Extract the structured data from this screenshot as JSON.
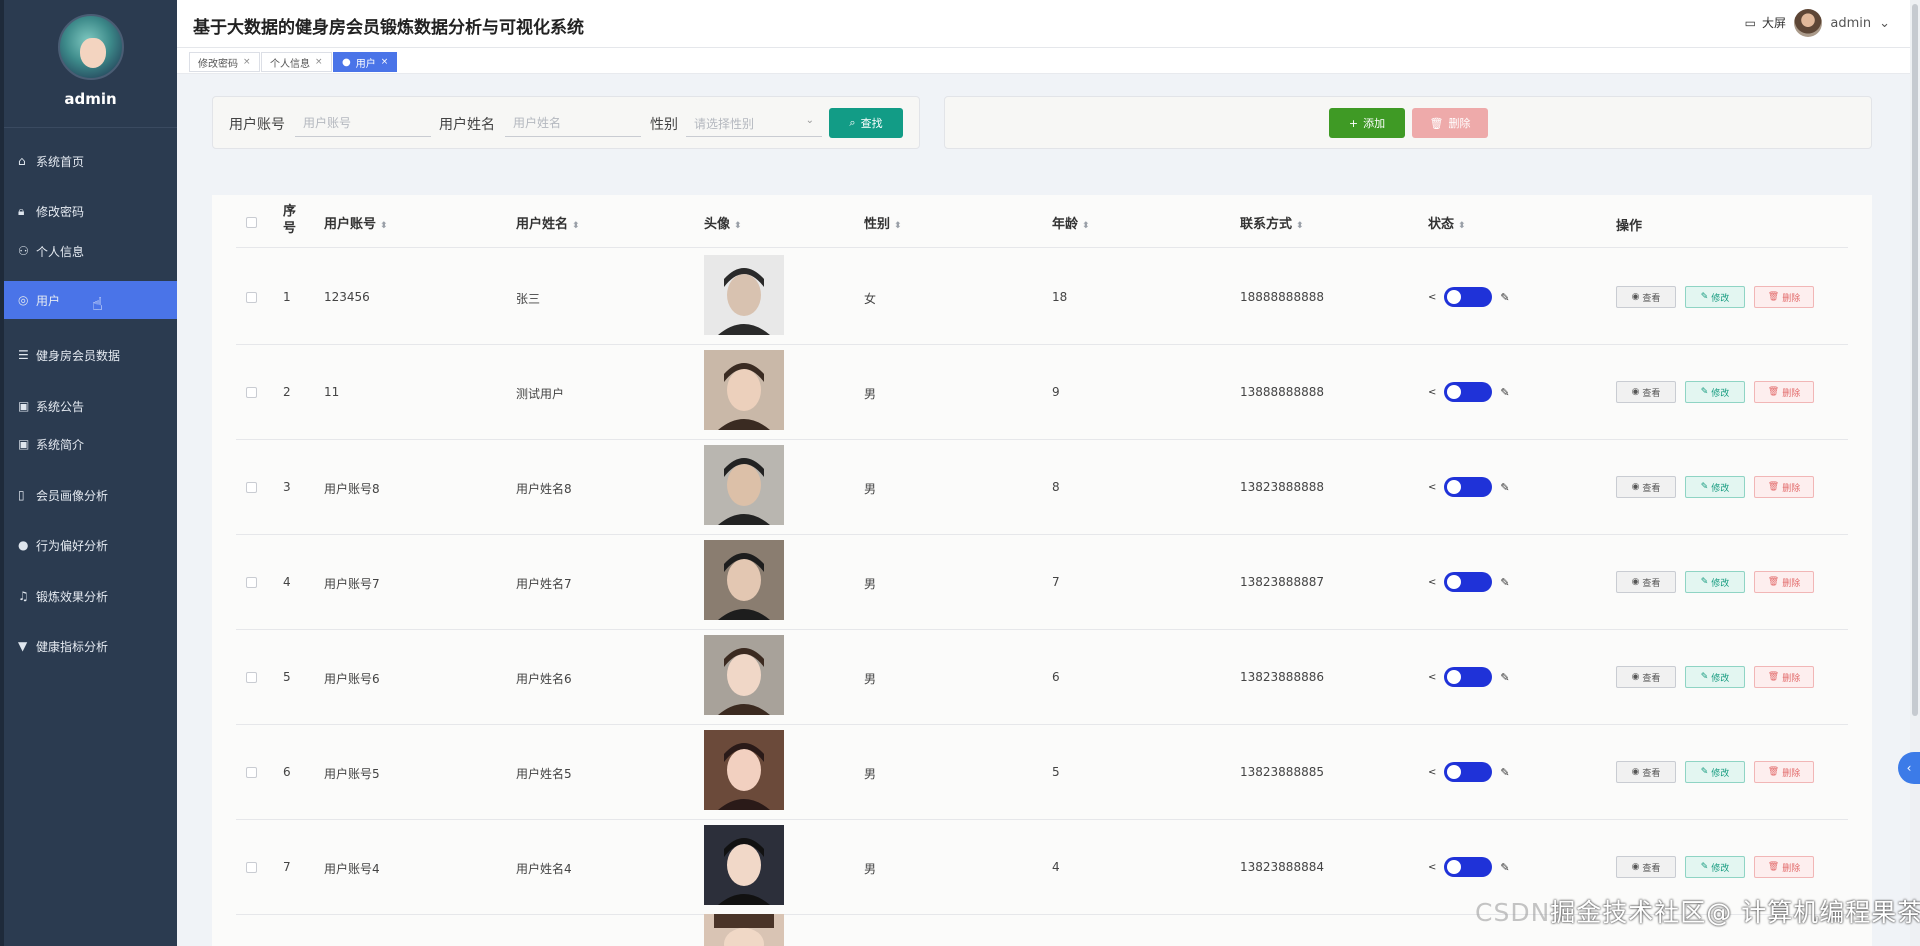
{
  "app": {
    "title": "基于大数据的健身房会员锻炼数据分析与可视化系统",
    "bigscreen_label": "大屏",
    "username": "admin"
  },
  "sidebar": {
    "profile_name": "admin",
    "items": [
      {
        "label": "系统首页",
        "icon": "home-icon"
      },
      {
        "label": "修改密码",
        "icon": "lock-icon"
      },
      {
        "label": "个人信息",
        "icon": "user-icon"
      },
      {
        "label": "用户",
        "icon": "globe-icon",
        "active": true
      },
      {
        "label": "健身房会员数据",
        "icon": "sliders-icon"
      },
      {
        "label": "系统公告",
        "icon": "clipboard-icon"
      },
      {
        "label": "系统简介",
        "icon": "clipboard-icon"
      },
      {
        "label": "会员画像分析",
        "icon": "phone-icon"
      },
      {
        "label": "行为偏好分析",
        "icon": "bulb-icon"
      },
      {
        "label": "锻炼效果分析",
        "icon": "bell-off-icon"
      },
      {
        "label": "健康指标分析",
        "icon": "trophy-icon"
      }
    ]
  },
  "tabs": [
    {
      "label": "修改密码"
    },
    {
      "label": "个人信息"
    },
    {
      "label": "用户",
      "active": true
    }
  ],
  "search": {
    "account_label": "用户账号",
    "account_placeholder": "用户账号",
    "name_label": "用户姓名",
    "name_placeholder": "用户姓名",
    "gender_label": "性别",
    "gender_placeholder": "请选择性别",
    "search_button": "查找"
  },
  "actions": {
    "add_button": "添加",
    "delete_button": "删除"
  },
  "table": {
    "headers": {
      "index": "序号",
      "account": "用户账号",
      "name": "用户姓名",
      "avatar": "头像",
      "gender": "性别",
      "age": "年龄",
      "phone": "联系方式",
      "status": "状态",
      "ops": "操作"
    },
    "op_labels": {
      "view": "查看",
      "edit": "修改",
      "delete": "删除"
    },
    "rows": [
      {
        "index": "1",
        "account": "123456",
        "name": "张三",
        "gender": "女",
        "age": "18",
        "phone": "18888888888"
      },
      {
        "index": "2",
        "account": "11",
        "name": "测试用户",
        "gender": "男",
        "age": "9",
        "phone": "13888888888"
      },
      {
        "index": "3",
        "account": "用户账号8",
        "name": "用户姓名8",
        "gender": "男",
        "age": "8",
        "phone": "13823888888"
      },
      {
        "index": "4",
        "account": "用户账号7",
        "name": "用户姓名7",
        "gender": "男",
        "age": "7",
        "phone": "13823888887"
      },
      {
        "index": "5",
        "account": "用户账号6",
        "name": "用户姓名6",
        "gender": "男",
        "age": "6",
        "phone": "13823888886"
      },
      {
        "index": "6",
        "account": "用户账号5",
        "name": "用户姓名5",
        "gender": "男",
        "age": "5",
        "phone": "13823888885"
      },
      {
        "index": "7",
        "account": "用户账号4",
        "name": "用户姓名4",
        "gender": "男",
        "age": "4",
        "phone": "13823888884"
      }
    ]
  },
  "watermark": {
    "part1": "掘金技术社区",
    "part2": "@ 计算机编程果茶熊",
    "underlay": "CSDN"
  }
}
